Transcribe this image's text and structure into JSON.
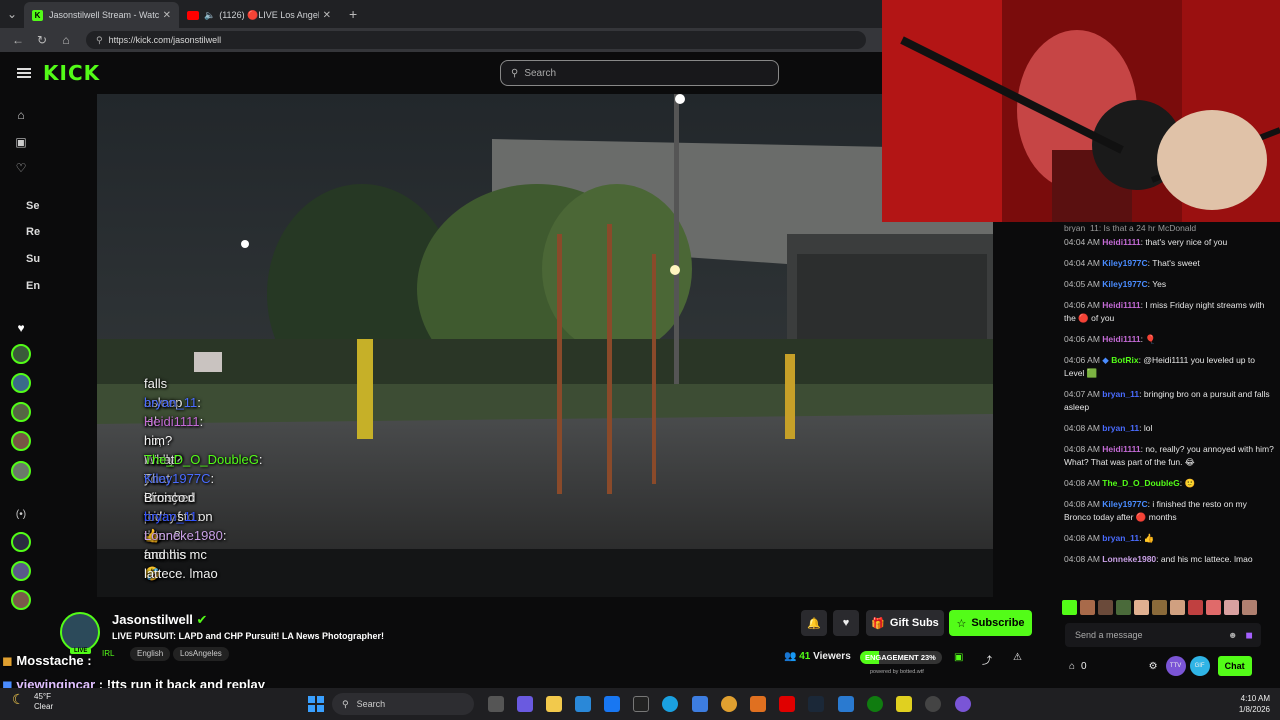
{
  "browser": {
    "tabs": [
      {
        "title": "Jasonstilwell Stream - Watch L",
        "active": true
      },
      {
        "title": "(1126) 🔴LIVE Los Angeles Po",
        "active": false
      }
    ],
    "new_tab": "+",
    "url": "https://kick.com/jasonstilwell"
  },
  "header": {
    "logo": "KICK",
    "search_placeholder": "Search"
  },
  "sidebar": {
    "sections": [
      "Se",
      "Re",
      "Su",
      "En"
    ]
  },
  "video_overlay": {
    "lines": [
      {
        "user": "",
        "text": "falls asleep",
        "user_color": "#ffffff"
      },
      {
        "user": "bryan_11",
        "text": ": lol",
        "user_color": "#4a6cff"
      },
      {
        "user": "Heidi1111",
        "text": ": no, really? you annoyed with",
        "user_color": "#c46bd6"
      },
      {
        "user": "",
        "text": "him? What? That was part of the fun. 🤣",
        "user_color": "#ffffff"
      },
      {
        "user": "The_D_O_DoubleG",
        "text": ": ",
        "user_color": "#53fc18"
      },
      {
        "user": "Kiley1977C",
        "text": ": i finished the resto on my",
        "user_color": "#4a6cff"
      },
      {
        "user": "",
        "text": "Bronco today after 8 months",
        "user_color": "#ffffff"
      },
      {
        "user": "bryan_11",
        "text": ": 👍",
        "user_color": "#3050ff"
      },
      {
        "user": "Lonneke1980",
        "text": ": and his mc lattece. lmao",
        "user_color": "#c9a0e6"
      }
    ]
  },
  "chat": {
    "top_partial": "bryan_11: Is that a 24 hr McDonald",
    "messages": [
      {
        "time": "04:04 AM",
        "user": "Heidi1111",
        "color": "#c46bd6",
        "text": ": that's very nice of you"
      },
      {
        "time": "04:04 AM",
        "user": "Kiley1977C",
        "color": "#4a8cff",
        "text": ": That's sweet"
      },
      {
        "time": "04:05 AM",
        "user": "Kiley1977C",
        "color": "#4a8cff",
        "text": ": Yes"
      },
      {
        "time": "04:06 AM",
        "user": "Heidi1111",
        "color": "#c46bd6",
        "text": ": I miss Friday night streams with the 🔴 of you"
      },
      {
        "time": "04:06 AM",
        "user": "Heidi1111",
        "color": "#c46bd6",
        "text": ": 🎈"
      },
      {
        "time": "04:06 AM",
        "user": "BotRix",
        "color": "#53fc18",
        "text": ": @Heidi1111 you leveled up to Level 🟩"
      },
      {
        "time": "04:07 AM",
        "user": "bryan_11",
        "color": "#4a6cff",
        "text": ": bringing bro on a pursuit and falls asleep"
      },
      {
        "time": "04:08 AM",
        "user": "bryan_11",
        "color": "#4a6cff",
        "text": ": lol"
      },
      {
        "time": "04:08 AM",
        "user": "Heidi1111",
        "color": "#c46bd6",
        "text": ": no, really? you annoyed with him? What? That was part of the fun. 😂"
      },
      {
        "time": "04:08 AM",
        "user": "The_D_O_DoubleG",
        "color": "#53fc18",
        "text": ": 🙂"
      },
      {
        "time": "04:08 AM",
        "user": "Kiley1977C",
        "color": "#4a8cff",
        "text": ": i finished the resto on my Bronco today after 🔴 months"
      },
      {
        "time": "04:08 AM",
        "user": "bryan_11",
        "color": "#4a6cff",
        "text": ": 👍"
      },
      {
        "time": "04:08 AM",
        "user": "Lonneke1980",
        "color": "#c9a0e6",
        "text": ": and his mc lattece. lmao"
      }
    ],
    "send_placeholder": "Send a message",
    "count": "0",
    "chat_button": "Chat"
  },
  "stream_info": {
    "streamer": "Jasonstilwell",
    "title": "LIVE PURSUIT: LAPD and CHP Pursuit! LA News Photographer!",
    "live_badge": "LIVE",
    "tags": [
      "IRL",
      "English",
      "LosAngeles"
    ],
    "gift_subs": "Gift Subs",
    "subscribe": "Subscribe",
    "viewers_count": "41",
    "viewers_label": "Viewers",
    "engagement": "ENGAGEMENT 23%",
    "engagement_level": 0.23,
    "powered_by": "powered by botted.wtf"
  },
  "overlay_bottom": {
    "line1_user": "Mosstache :",
    "line2_user": "viewingincar",
    "line2_text": ": !tts run it back and replay"
  },
  "taskbar": {
    "weather_temp": "45°F",
    "weather_cond": "Clear",
    "search": "Search",
    "time": "4:10 AM",
    "date": "1/8/2026"
  }
}
